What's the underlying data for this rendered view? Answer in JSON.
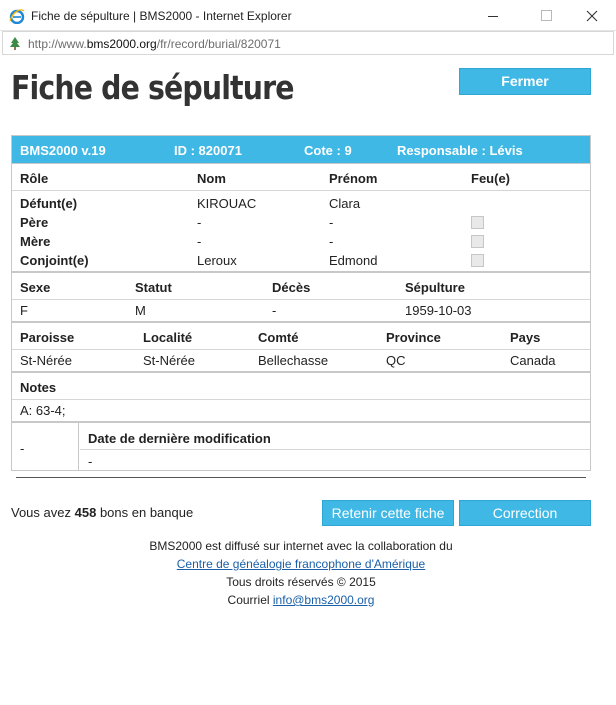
{
  "window": {
    "title": "Fiche de sépulture | BMS2000 - Internet Explorer",
    "url_prefix": "http://www.",
    "url_domain": "bms2000.org",
    "url_path": "/fr/record/burial/820071"
  },
  "page": {
    "title": "Fiche de sépulture",
    "close_label": "Fermer"
  },
  "record": {
    "header": {
      "version": "BMS2000 v.19",
      "id": "ID : 820071",
      "cote": "Cote : 9",
      "responsable": "Responsable : Lévis"
    },
    "persons_headers": [
      "Rôle",
      "Nom",
      "Prénom",
      "Feu(e)"
    ],
    "persons": [
      {
        "role": "Défunt(e)",
        "nom": "KIROUAC",
        "prenom": "Clara",
        "checkbox": false
      },
      {
        "role": "Père",
        "nom": "-",
        "prenom": "-",
        "checkbox": true
      },
      {
        "role": "Mère",
        "nom": "-",
        "prenom": "-",
        "checkbox": true
      },
      {
        "role": "Conjoint(e)",
        "nom": "Leroux",
        "prenom": "Edmond",
        "checkbox": true
      }
    ],
    "vital_headers": [
      "Sexe",
      "Statut",
      "Décès",
      "Sépulture"
    ],
    "vital_values": [
      "F",
      "M",
      "-",
      "1959-10-03"
    ],
    "place_headers": [
      "Paroisse",
      "Localité",
      "Comté",
      "Province",
      "Pays"
    ],
    "place_values": [
      "St-Nérée",
      "St-Nérée",
      "Bellechasse",
      "QC",
      "Canada"
    ],
    "notes_label": "Notes",
    "notes_value": "A: 63-4;",
    "mod_left": "-",
    "mod_label": "Date de dernière modification",
    "mod_value": "-"
  },
  "bank": {
    "prefix": "Vous avez",
    "count": "458",
    "suffix": "bons en banque"
  },
  "actions": {
    "keep_label": "Retenir cette fiche",
    "correction_label": "Correction"
  },
  "footer": {
    "line1": "BMS2000 est diffusé sur internet avec la collaboration du",
    "link1": "Centre de généalogie francophone d'Amérique",
    "line3": "Tous droits réservés © 2015",
    "contact_label": "Courriel",
    "contact_email": "info@bms2000.org"
  },
  "colors": {
    "accent": "#3fb8e6"
  }
}
